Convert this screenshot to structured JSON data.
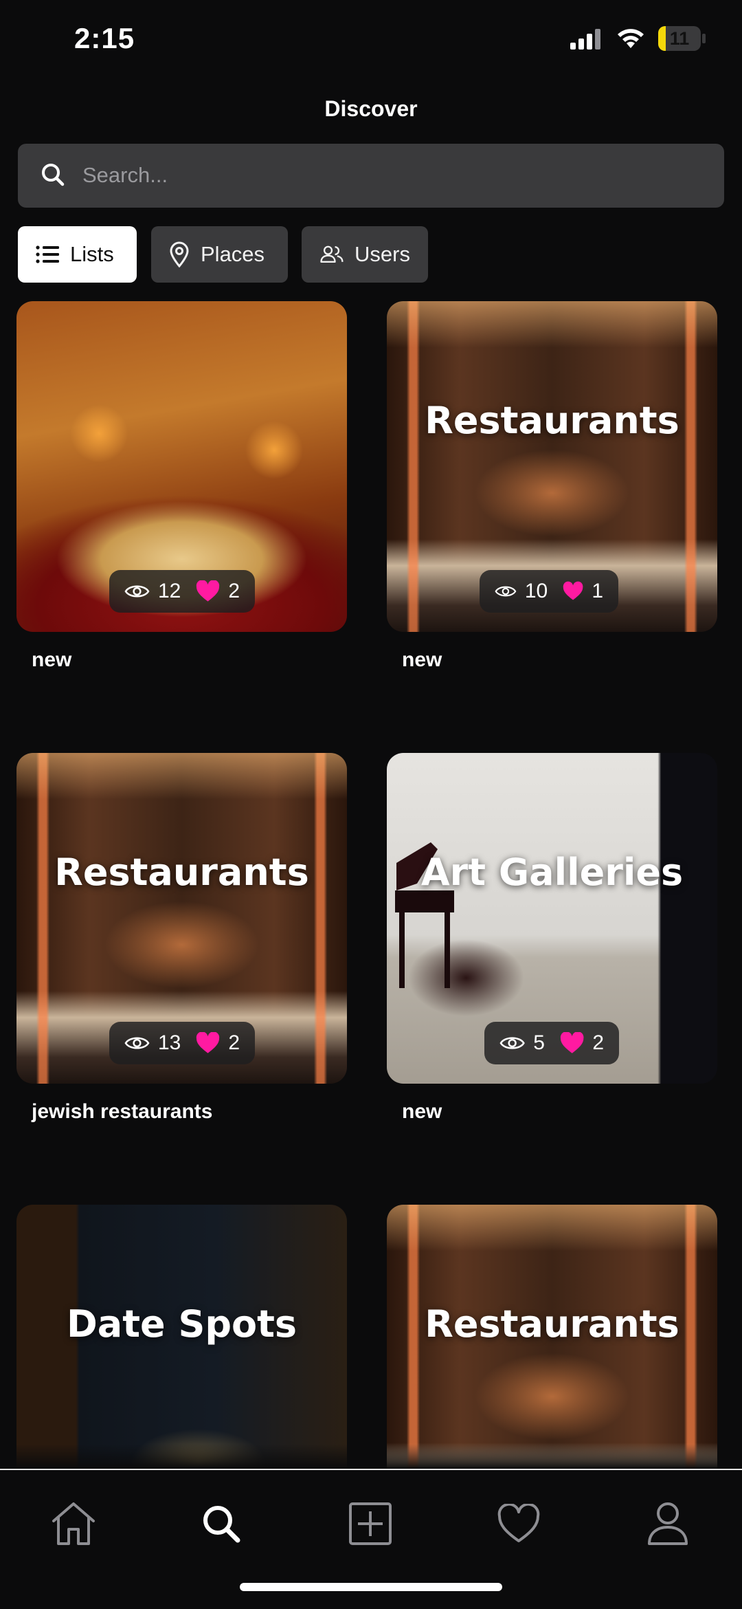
{
  "status": {
    "time": "2:15",
    "battery": "11",
    "battery_level": 0.11
  },
  "header": {
    "title": "Discover"
  },
  "search": {
    "placeholder": "Search..."
  },
  "filters": [
    {
      "label": "Lists",
      "icon": "list-icon",
      "active": true
    },
    {
      "label": "Places",
      "icon": "map-pin-icon",
      "active": false
    },
    {
      "label": "Users",
      "icon": "users-icon",
      "active": false
    }
  ],
  "cards": [
    {
      "overlay": "",
      "views": "12",
      "likes": "2",
      "caption": "new",
      "image": "restaurant-mural-photo"
    },
    {
      "overlay": "Restaurants",
      "views": "10",
      "likes": "1",
      "caption": "new",
      "image": "restaurant-interior-photo"
    },
    {
      "overlay": "Restaurants",
      "views": "13",
      "likes": "2",
      "caption": "jewish restaurants",
      "image": "restaurant-interior-photo"
    },
    {
      "overlay": "Art Galleries",
      "views": "5",
      "likes": "2",
      "caption": "new",
      "image": "art-gallery-photo"
    },
    {
      "overlay": "Date Spots",
      "views": "",
      "likes": "",
      "caption": "",
      "image": "city-view-restaurant-photo"
    },
    {
      "overlay": "Restaurants",
      "views": "",
      "likes": "",
      "caption": "",
      "image": "restaurant-interior-photo"
    }
  ],
  "tabbar": [
    {
      "icon": "home-icon",
      "active": false
    },
    {
      "icon": "search-icon",
      "active": true
    },
    {
      "icon": "add-square-icon",
      "active": false
    },
    {
      "icon": "heart-icon",
      "active": false
    },
    {
      "icon": "profile-icon",
      "active": false
    }
  ],
  "colors": {
    "background": "#0b0b0c",
    "chip_bg": "#3a3a3c",
    "like": "#ff1aa1",
    "battery": "#f5d90a"
  }
}
